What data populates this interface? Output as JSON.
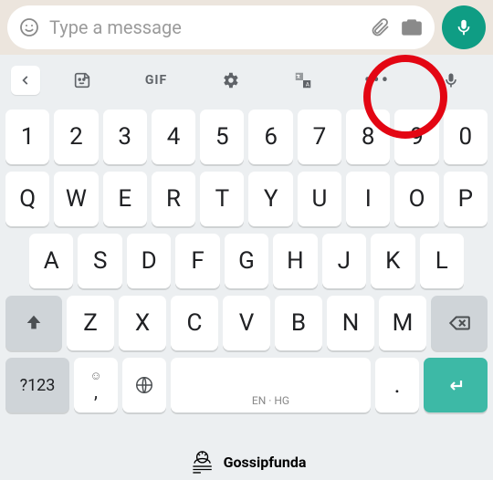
{
  "chat": {
    "placeholder": "Type a message"
  },
  "toolbar": {
    "gif_label": "GIF",
    "more_label": "•••"
  },
  "rows": {
    "numbers": [
      "1",
      "2",
      "3",
      "4",
      "5",
      "6",
      "7",
      "8",
      "9",
      "0"
    ],
    "letters1": [
      "Q",
      "W",
      "E",
      "R",
      "T",
      "Y",
      "U",
      "I",
      "O",
      "P"
    ],
    "letters2": [
      "A",
      "S",
      "D",
      "F",
      "G",
      "H",
      "J",
      "K",
      "L"
    ],
    "letters3": [
      "Z",
      "X",
      "C",
      "V",
      "B",
      "N",
      "M"
    ]
  },
  "bottom": {
    "symbols": "?123",
    "comma": ",",
    "space_lang": "EN · HG",
    "period": "."
  },
  "watermark": "Gossipfunda"
}
